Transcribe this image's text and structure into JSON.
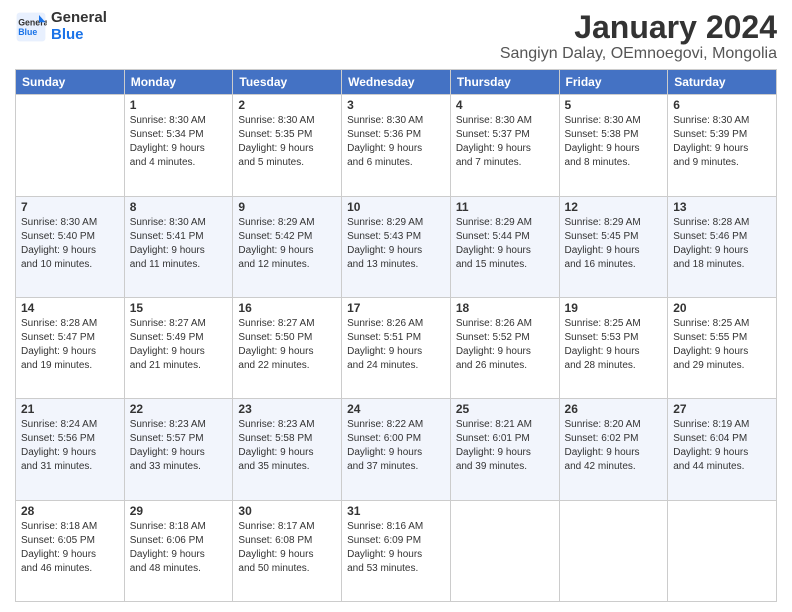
{
  "header": {
    "logo_line1": "General",
    "logo_line2": "Blue",
    "main_title": "January 2024",
    "subtitle": "Sangiyn Dalay, OEmnoegovi, Mongolia"
  },
  "weekdays": [
    "Sunday",
    "Monday",
    "Tuesday",
    "Wednesday",
    "Thursday",
    "Friday",
    "Saturday"
  ],
  "weeks": [
    [
      {
        "day": "",
        "info": ""
      },
      {
        "day": "1",
        "info": "Sunrise: 8:30 AM\nSunset: 5:34 PM\nDaylight: 9 hours\nand 4 minutes."
      },
      {
        "day": "2",
        "info": "Sunrise: 8:30 AM\nSunset: 5:35 PM\nDaylight: 9 hours\nand 5 minutes."
      },
      {
        "day": "3",
        "info": "Sunrise: 8:30 AM\nSunset: 5:36 PM\nDaylight: 9 hours\nand 6 minutes."
      },
      {
        "day": "4",
        "info": "Sunrise: 8:30 AM\nSunset: 5:37 PM\nDaylight: 9 hours\nand 7 minutes."
      },
      {
        "day": "5",
        "info": "Sunrise: 8:30 AM\nSunset: 5:38 PM\nDaylight: 9 hours\nand 8 minutes."
      },
      {
        "day": "6",
        "info": "Sunrise: 8:30 AM\nSunset: 5:39 PM\nDaylight: 9 hours\nand 9 minutes."
      }
    ],
    [
      {
        "day": "7",
        "info": "Sunrise: 8:30 AM\nSunset: 5:40 PM\nDaylight: 9 hours\nand 10 minutes."
      },
      {
        "day": "8",
        "info": "Sunrise: 8:30 AM\nSunset: 5:41 PM\nDaylight: 9 hours\nand 11 minutes."
      },
      {
        "day": "9",
        "info": "Sunrise: 8:29 AM\nSunset: 5:42 PM\nDaylight: 9 hours\nand 12 minutes."
      },
      {
        "day": "10",
        "info": "Sunrise: 8:29 AM\nSunset: 5:43 PM\nDaylight: 9 hours\nand 13 minutes."
      },
      {
        "day": "11",
        "info": "Sunrise: 8:29 AM\nSunset: 5:44 PM\nDaylight: 9 hours\nand 15 minutes."
      },
      {
        "day": "12",
        "info": "Sunrise: 8:29 AM\nSunset: 5:45 PM\nDaylight: 9 hours\nand 16 minutes."
      },
      {
        "day": "13",
        "info": "Sunrise: 8:28 AM\nSunset: 5:46 PM\nDaylight: 9 hours\nand 18 minutes."
      }
    ],
    [
      {
        "day": "14",
        "info": "Sunrise: 8:28 AM\nSunset: 5:47 PM\nDaylight: 9 hours\nand 19 minutes."
      },
      {
        "day": "15",
        "info": "Sunrise: 8:27 AM\nSunset: 5:49 PM\nDaylight: 9 hours\nand 21 minutes."
      },
      {
        "day": "16",
        "info": "Sunrise: 8:27 AM\nSunset: 5:50 PM\nDaylight: 9 hours\nand 22 minutes."
      },
      {
        "day": "17",
        "info": "Sunrise: 8:26 AM\nSunset: 5:51 PM\nDaylight: 9 hours\nand 24 minutes."
      },
      {
        "day": "18",
        "info": "Sunrise: 8:26 AM\nSunset: 5:52 PM\nDaylight: 9 hours\nand 26 minutes."
      },
      {
        "day": "19",
        "info": "Sunrise: 8:25 AM\nSunset: 5:53 PM\nDaylight: 9 hours\nand 28 minutes."
      },
      {
        "day": "20",
        "info": "Sunrise: 8:25 AM\nSunset: 5:55 PM\nDaylight: 9 hours\nand 29 minutes."
      }
    ],
    [
      {
        "day": "21",
        "info": "Sunrise: 8:24 AM\nSunset: 5:56 PM\nDaylight: 9 hours\nand 31 minutes."
      },
      {
        "day": "22",
        "info": "Sunrise: 8:23 AM\nSunset: 5:57 PM\nDaylight: 9 hours\nand 33 minutes."
      },
      {
        "day": "23",
        "info": "Sunrise: 8:23 AM\nSunset: 5:58 PM\nDaylight: 9 hours\nand 35 minutes."
      },
      {
        "day": "24",
        "info": "Sunrise: 8:22 AM\nSunset: 6:00 PM\nDaylight: 9 hours\nand 37 minutes."
      },
      {
        "day": "25",
        "info": "Sunrise: 8:21 AM\nSunset: 6:01 PM\nDaylight: 9 hours\nand 39 minutes."
      },
      {
        "day": "26",
        "info": "Sunrise: 8:20 AM\nSunset: 6:02 PM\nDaylight: 9 hours\nand 42 minutes."
      },
      {
        "day": "27",
        "info": "Sunrise: 8:19 AM\nSunset: 6:04 PM\nDaylight: 9 hours\nand 44 minutes."
      }
    ],
    [
      {
        "day": "28",
        "info": "Sunrise: 8:18 AM\nSunset: 6:05 PM\nDaylight: 9 hours\nand 46 minutes."
      },
      {
        "day": "29",
        "info": "Sunrise: 8:18 AM\nSunset: 6:06 PM\nDaylight: 9 hours\nand 48 minutes."
      },
      {
        "day": "30",
        "info": "Sunrise: 8:17 AM\nSunset: 6:08 PM\nDaylight: 9 hours\nand 50 minutes."
      },
      {
        "day": "31",
        "info": "Sunrise: 8:16 AM\nSunset: 6:09 PM\nDaylight: 9 hours\nand 53 minutes."
      },
      {
        "day": "",
        "info": ""
      },
      {
        "day": "",
        "info": ""
      },
      {
        "day": "",
        "info": ""
      }
    ]
  ]
}
